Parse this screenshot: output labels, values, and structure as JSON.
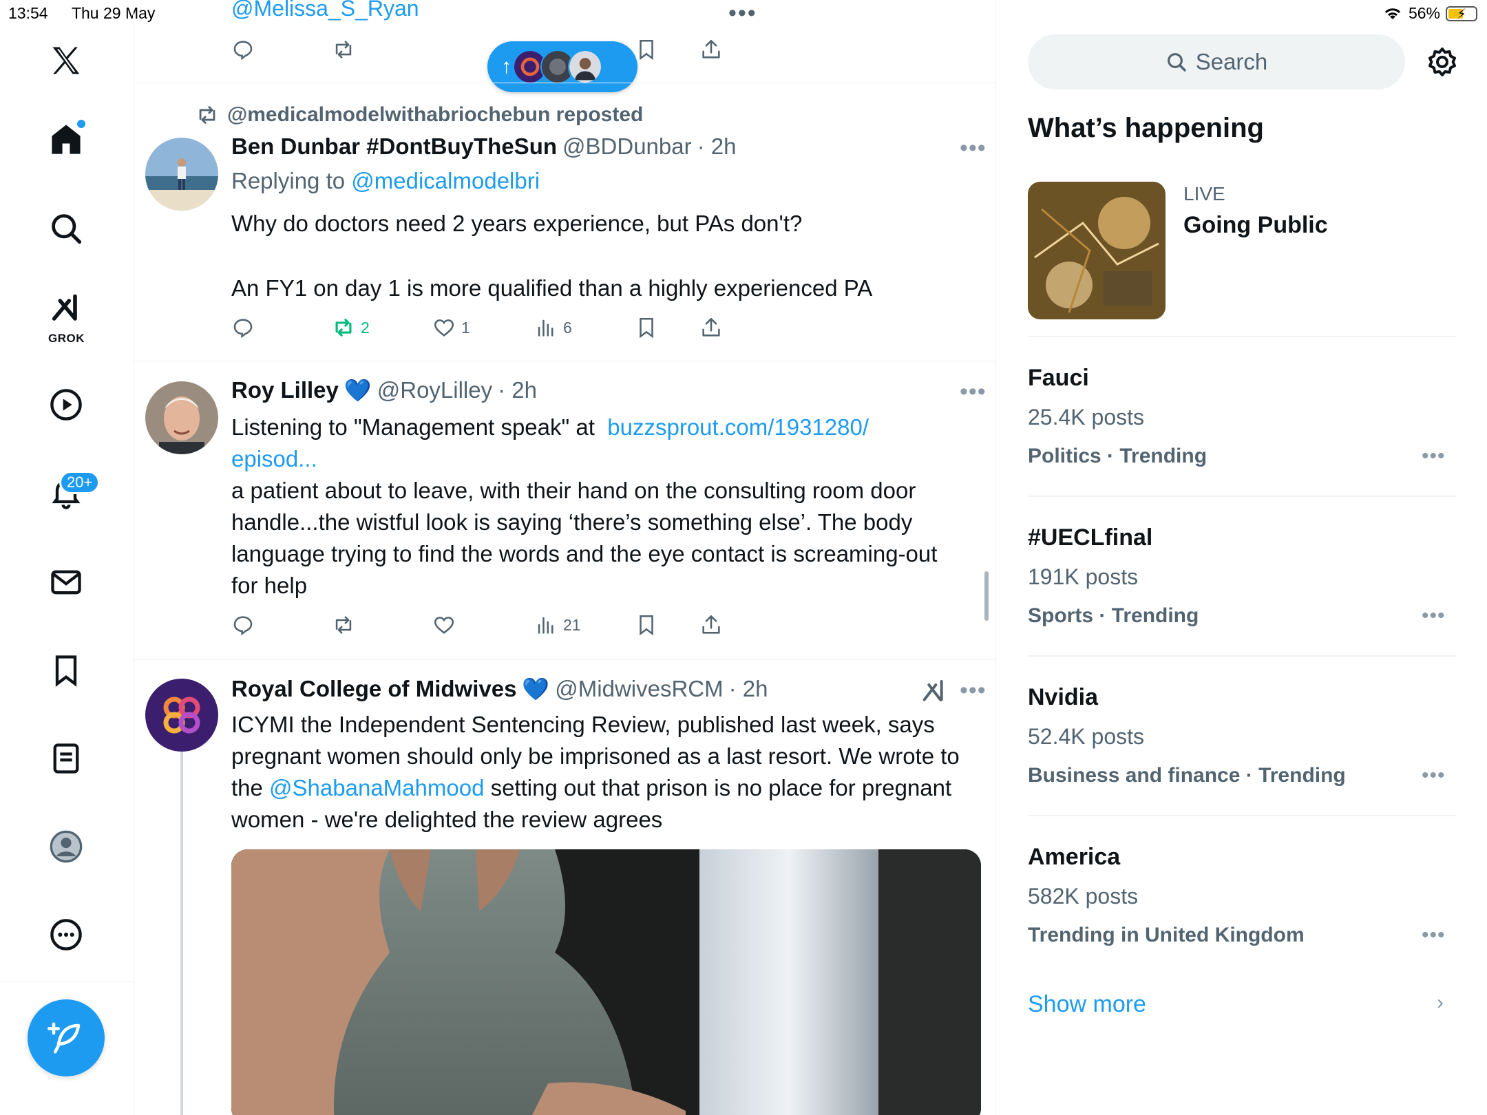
{
  "status_bar": {
    "time": "13:54",
    "date": "Thu 29 May",
    "battery": "56%",
    "battery_level": 0.56
  },
  "nav": {
    "grok_label": "GROK",
    "notifications_badge": "20+"
  },
  "feed": {
    "previous_handle": "@Melissa_S_Ryan",
    "more_label": "•••",
    "posts": [
      {
        "reposted_by": "@medicalmodelwithabriochebun reposted",
        "name": "Ben Dunbar #DontBuyTheSun",
        "handle": "@BDDunbar",
        "time": "· 2h",
        "reply_label": "Replying to",
        "reply_to": "@medicalmodelbri",
        "text_1": "Why do doctors need 2 years experience, but PAs don't?",
        "text_2": "An FY1 on day 1 is more qualified than a highly experienced PA",
        "reposts": "2",
        "likes": "1",
        "views": "6"
      },
      {
        "name": "Roy Lilley",
        "handle": "@RoyLilley",
        "time": "· 2h",
        "text_prefix": "Listening to \"Management speak\" at",
        "link_1": "buzzsprout.com/1931280/",
        "link_2": "episod...",
        "text_body": "a patient about to leave, with their hand on the consulting room door handle...the wistful look is saying ‘there’s something else’. The body language trying to find the words and the eye contact is screaming-out for help",
        "views": "21"
      },
      {
        "name": "Royal College of Midwives",
        "handle": "@MidwivesRCM",
        "time": "· 2h",
        "text_a": "ICYMI the Independent Sentencing Review, published last week, says pregnant women should only be imprisoned as a last resort. We wrote to the",
        "mention": "@ShabanaMahmood",
        "text_b": "setting out that prison is no place for pregnant women - we're delighted the review agrees"
      }
    ]
  },
  "sidebar": {
    "search_placeholder": "Search",
    "section_title": "What’s happening",
    "live": {
      "label": "LIVE",
      "title": "Going Public"
    },
    "trends": [
      {
        "name": "Fauci",
        "count": "25.4K posts",
        "category": "Politics · Trending"
      },
      {
        "name": "#UECLfinal",
        "count": "191K posts",
        "category": "Sports · Trending"
      },
      {
        "name": "Nvidia",
        "count": "52.4K posts",
        "category": "Business and finance · Trending"
      },
      {
        "name": "America",
        "count": "582K posts",
        "category": "Trending in United Kingdom"
      }
    ],
    "show_more": "Show more"
  },
  "colors": {
    "accent": "#1d9bf0",
    "repost_active": "#00ba7c",
    "secondary_text": "#536471"
  }
}
